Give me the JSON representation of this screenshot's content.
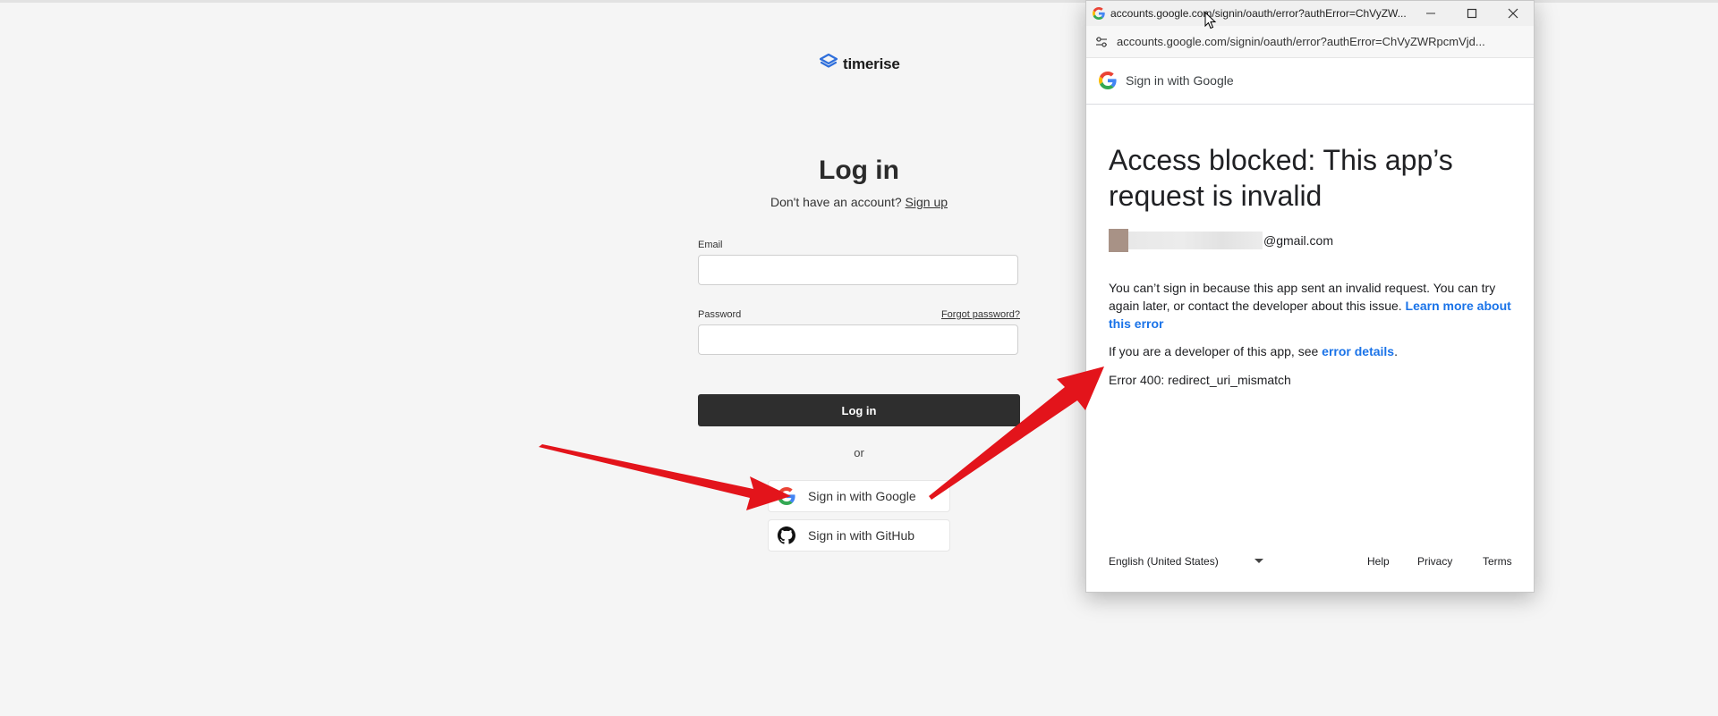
{
  "brand": {
    "name": "timerise"
  },
  "login": {
    "title": "Log in",
    "no_account_text": "Don't have an account?",
    "signup_link": "Sign up",
    "email_label": "Email",
    "email_value": "",
    "password_label": "Password",
    "password_value": "",
    "forgot_link": "Forgot password?",
    "login_button": "Log in",
    "or_text": "or",
    "google_button": "Sign in with Google",
    "github_button": "Sign in with GitHub"
  },
  "popup": {
    "window_title": "accounts.google.com/signin/oauth/error?authError=ChVyZW...",
    "url": "accounts.google.com/signin/oauth/error?authError=ChVyZWRpcmVjd...",
    "header_text": "Sign in with Google",
    "heading": "Access blocked: This app’s request is invalid",
    "email_domain": "@gmail.com",
    "message": "You can’t sign in because this app sent an invalid request. You can try again later, or contact the developer about this issue.",
    "learn_more_link": "Learn more about this error",
    "developer_text": "If you are a developer of this app, see",
    "error_details_link": "error details",
    "error_code": "Error 400: redirect_uri_mismatch",
    "footer": {
      "language": "English (United States)",
      "help": "Help",
      "privacy": "Privacy",
      "terms": "Terms"
    }
  },
  "colors": {
    "page_background": "#f5f5f5",
    "login_button": "#2e2e2e",
    "google_link": "#1a73e8",
    "annotation_arrow": "#e3141b",
    "brand_blue": "#2f6fdb"
  },
  "icons": [
    "timerise-logo-icon",
    "google-g-icon",
    "github-icon",
    "minimize-icon",
    "maximize-icon",
    "close-icon",
    "site-settings-icon",
    "chevron-down-icon",
    "cursor-icon"
  ]
}
